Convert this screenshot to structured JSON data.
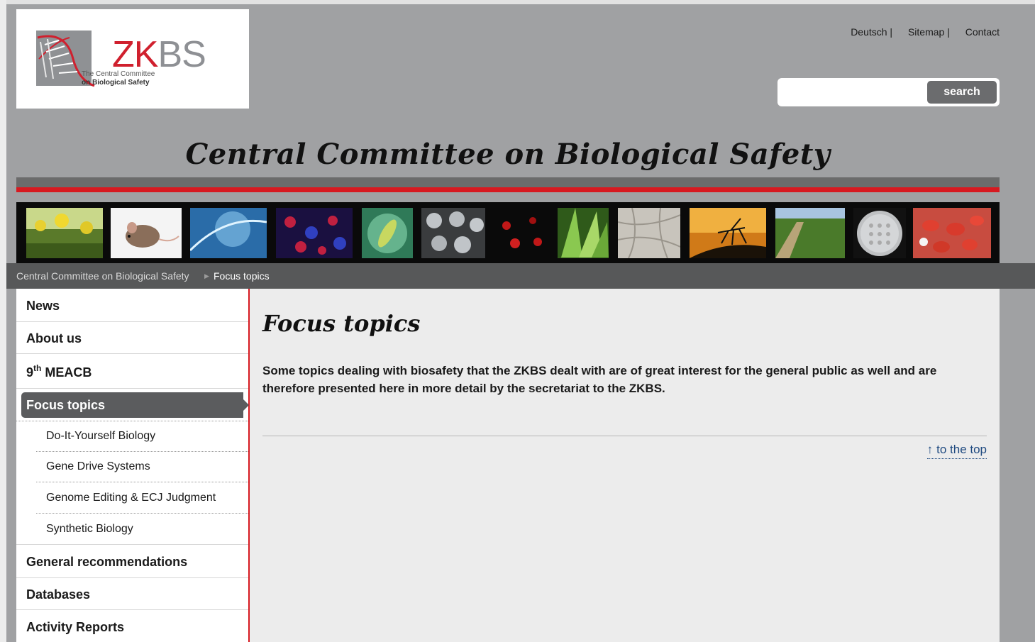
{
  "header": {
    "logo": {
      "name_red": "ZK",
      "name_gray": "BS",
      "subtitle_line1": "The Central Committee",
      "subtitle_line2": "on Biological Safety"
    },
    "links": [
      "Deutsch |",
      "Sitemap |",
      "Contact"
    ],
    "search": {
      "placeholder": "",
      "button_label": "search"
    },
    "site_title": "Central Committee on Biological Safety"
  },
  "photo_strip": {
    "images": [
      "rapeseed-field",
      "mouse",
      "dna-helix",
      "fluorescent-cells",
      "bacterium",
      "virus-particles",
      "red-fluorescence",
      "plant-leaves",
      "fungal-hyphae",
      "mosquito-sunset",
      "corn-field",
      "petri-dish",
      "red-blood-cells"
    ]
  },
  "breadcrumb": {
    "items": [
      "Central Committee on Biological Safety",
      "Focus topics"
    ]
  },
  "sidebar": {
    "items": [
      {
        "label": "News"
      },
      {
        "label": "About us"
      },
      {
        "label_main": "MEACB",
        "sup": "th",
        "num": "9"
      },
      {
        "label": "Focus topics",
        "active": true
      },
      {
        "label": "General recommendations"
      },
      {
        "label": "Databases"
      },
      {
        "label": "Activity Reports"
      }
    ],
    "subitems": [
      "Do-It-Yourself Biology",
      "Gene Drive Systems",
      "Genome Editing & ECJ Judgment",
      "Synthetic Biology"
    ]
  },
  "main": {
    "title": "Focus topics",
    "intro": "Some topics dealing with biosafety that the ZKBS dealt with are of great interest for the general public as well and are therefore presented here in more detail by the secretariat to the ZKBS.",
    "to_top": "to the top"
  },
  "colors": {
    "accent_red": "#d71920",
    "header_gray": "#a0a1a3",
    "breadcrumb_gray": "#575859",
    "content_bg": "#ececec",
    "link_blue": "#1f4a80"
  }
}
